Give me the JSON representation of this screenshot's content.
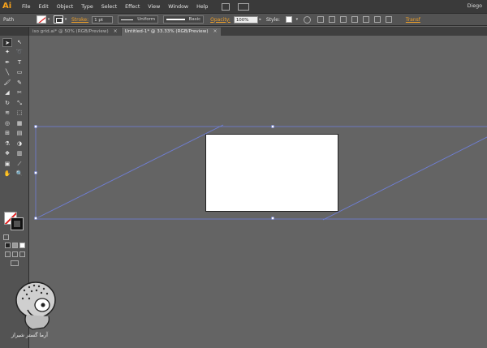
{
  "app": {
    "logo": "Ai",
    "user": "Diego"
  },
  "menu": [
    "File",
    "Edit",
    "Object",
    "Type",
    "Select",
    "Effect",
    "View",
    "Window",
    "Help"
  ],
  "control_bar": {
    "selection_type": "Path",
    "stroke_label": "Stroke:",
    "stroke_weight": "1 pt",
    "profile": "Uniform",
    "brush": "Basic",
    "opacity_label": "Opacity:",
    "opacity": "100%",
    "style_label": "Style:",
    "transform_label": "Transf"
  },
  "tabs": [
    {
      "label": "iso grid.ai* @ 50% (RGB/Preview)",
      "active": false
    },
    {
      "label": "Untitled-1* @ 33.33% (RGB/Preview)",
      "active": true
    }
  ],
  "tools": [
    "selection-tool",
    "direct-selection-tool",
    "magic-wand-tool",
    "lasso-tool",
    "pen-tool",
    "type-tool",
    "line-tool",
    "rectangle-tool",
    "paintbrush-tool",
    "pencil-tool",
    "blob-brush-tool",
    "eraser-tool",
    "rotate-tool",
    "scale-tool",
    "width-tool",
    "free-transform-tool",
    "shape-builder-tool",
    "perspective-grid-tool",
    "mesh-tool",
    "gradient-tool",
    "eyedropper-tool",
    "blend-tool",
    "symbol-sprayer-tool",
    "column-graph-tool",
    "artboard-tool",
    "slice-tool",
    "hand-tool",
    "zoom-tool"
  ],
  "watermark": {
    "text": "آرما گستر شیراز"
  },
  "colors": {
    "canvas": "#646464",
    "selection": "#6f7fd8",
    "panel": "#535353",
    "accent": "#f0a028"
  }
}
